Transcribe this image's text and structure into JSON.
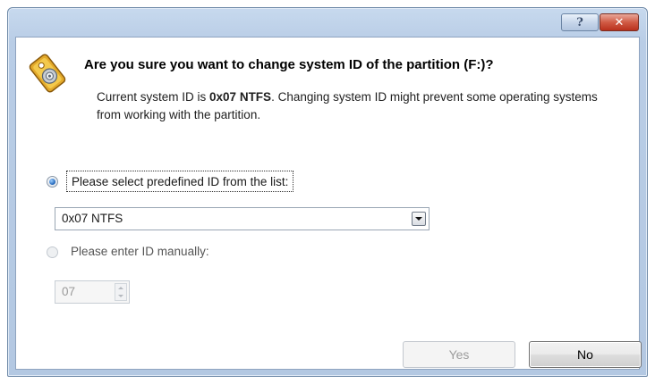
{
  "titlebar": {
    "help_label": "?",
    "close_label": "✕"
  },
  "dialog": {
    "question": "Are you sure you want to change system ID of the partition (F:)?",
    "info_prefix": "Current system ID is ",
    "info_current_id": "0x07 NTFS",
    "info_suffix": ". Changing system ID might prevent some operating systems from working with the partition.",
    "icon": "partition-tag-icon"
  },
  "options": {
    "predefined_label": "Please select predefined ID from the list:",
    "predefined_selected": true,
    "predefined_value": "0x07 NTFS",
    "manual_label": "Please enter ID manually:",
    "manual_selected": false,
    "manual_value": "07"
  },
  "buttons": {
    "yes_label": "Yes",
    "yes_enabled": false,
    "no_label": "No"
  },
  "colors": {
    "frame": "#b9cde6",
    "close_red": "#c9432d",
    "radio_blue": "#1c62b8"
  }
}
